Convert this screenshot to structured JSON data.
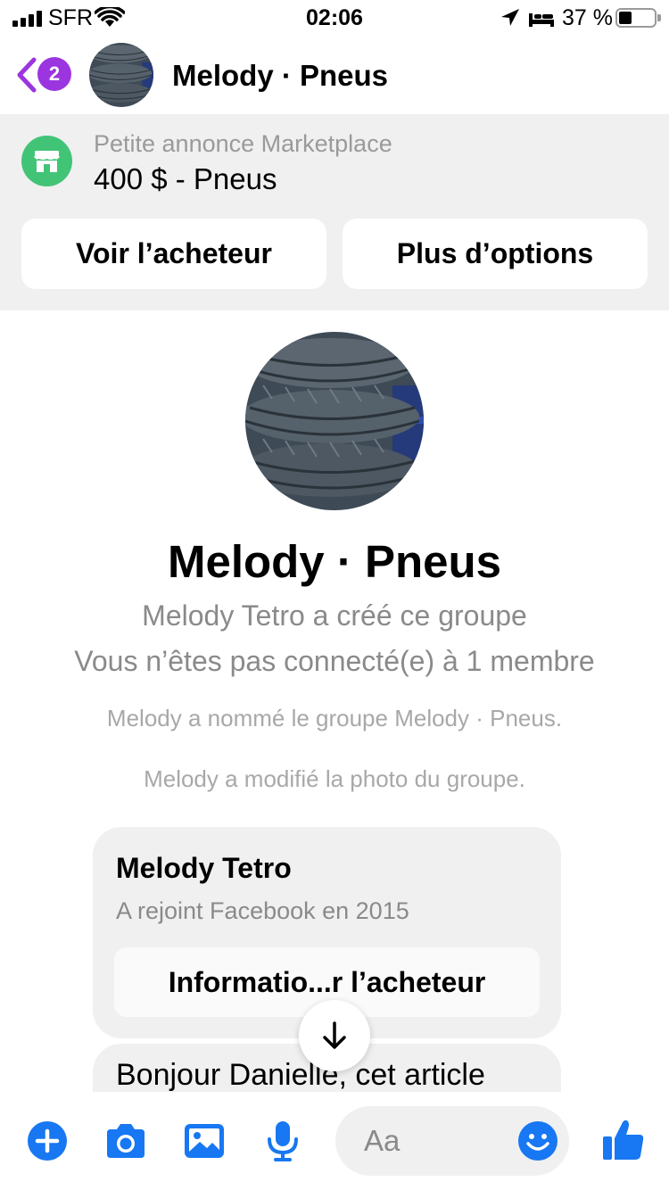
{
  "status_bar": {
    "carrier": "SFR",
    "time": "02:06",
    "battery_pct": "37 %",
    "battery_level": 0.37
  },
  "header": {
    "back_badge": "2",
    "title": "Melody · Pneus"
  },
  "marketplace": {
    "subtitle": "Petite annonce Marketplace",
    "title": "400 $ - Pneus",
    "view_buyer_label": "Voir l’acheteur",
    "more_options_label": "Plus d’options"
  },
  "group": {
    "name": "Melody · Pneus",
    "created_by": "Melody Tetro a créé ce groupe",
    "connection": "Vous n’êtes pas connecté(e) à 1 membre",
    "event_rename": "Melody a nommé le groupe Melody · Pneus.",
    "event_photo": "Melody a modifié la photo du groupe."
  },
  "buyer_card": {
    "name": "Melody Tetro",
    "joined": "A rejoint Facebook en 2015",
    "button_label": "Informatio...r l’acheteur"
  },
  "message": {
    "text": "Bonjour Danielle, cet article"
  },
  "composer": {
    "placeholder": "Aa"
  },
  "colors": {
    "messenger_blue": "#1877f2",
    "badge_purple": "#9b35e0",
    "marketplace_green": "#42c477",
    "panel_grey": "#f0f0f0"
  },
  "icons": [
    "signal-icon",
    "wifi-icon",
    "location-icon",
    "bed-icon",
    "battery-icon",
    "back-chevron-icon",
    "storefront-icon",
    "arrow-down-icon",
    "plus-icon",
    "camera-icon",
    "image-icon",
    "microphone-icon",
    "emoji-icon",
    "thumbs-up-icon"
  ]
}
